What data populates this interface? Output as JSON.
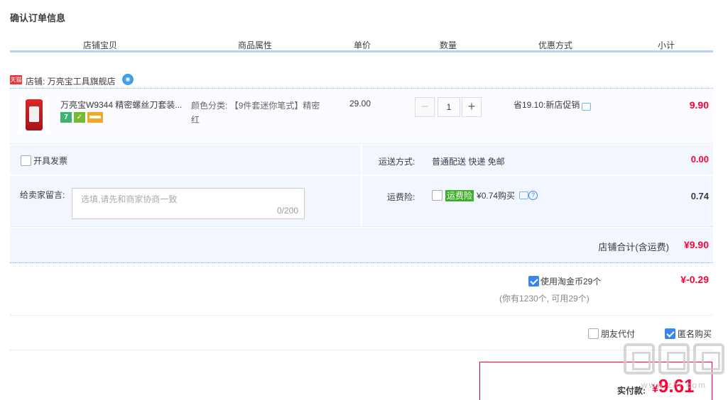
{
  "page": {
    "title": "确认订单信息"
  },
  "columns": [
    "店铺宝贝",
    "商品属性",
    "单价",
    "数量",
    "优惠方式",
    "小计"
  ],
  "shop": {
    "badge": "天猫",
    "label": "店铺: 万亮宝工具旗舰店"
  },
  "item": {
    "title": "万亮宝W9344 精密螺丝刀套装...",
    "service_icons": [
      "7-day-return-icon",
      "guarantee-icon",
      "credit-card-icon"
    ],
    "service_seven": "7",
    "attr_label": "颜色分类:",
    "attr_value": "【9件套迷你笔式】精密红",
    "price": "29.00",
    "qty": "1",
    "qty_minus": "−",
    "qty_plus": "+",
    "promo": "省19.10:新店促销",
    "subtotal": "9.90"
  },
  "invoice": {
    "label": "开具发票",
    "checked": false
  },
  "message": {
    "label": "给卖家留言:",
    "placeholder": "选填,请先和商家协商一致",
    "count": "0/200"
  },
  "shipping": {
    "label": "运送方式:",
    "value": "普通配送 快递 免邮",
    "fee": "0.00"
  },
  "insurance": {
    "label": "运费险:",
    "tag": "运费险",
    "text": "¥0.74购买",
    "fee": "0.74",
    "help": "?"
  },
  "shop_total": {
    "label": "店铺合计(含运费)",
    "value": "¥9.90"
  },
  "coins": {
    "label": "使用淘金币29个",
    "value": "¥-0.29",
    "hint": "(你有1230个, 可用29个)",
    "checked": true
  },
  "options": {
    "friend_pay": "朋友代付",
    "anonymous": "匿名购买"
  },
  "payment": {
    "label": "实付款:",
    "yen": "¥",
    "value": "9.61"
  },
  "watermark": {
    "text": "www.zhi.com"
  },
  "colors": {
    "accent": "#ff0036",
    "blue": "#3a84f3",
    "header_line": "#b2d1ff",
    "panel_bg": "#f2f7ff"
  }
}
